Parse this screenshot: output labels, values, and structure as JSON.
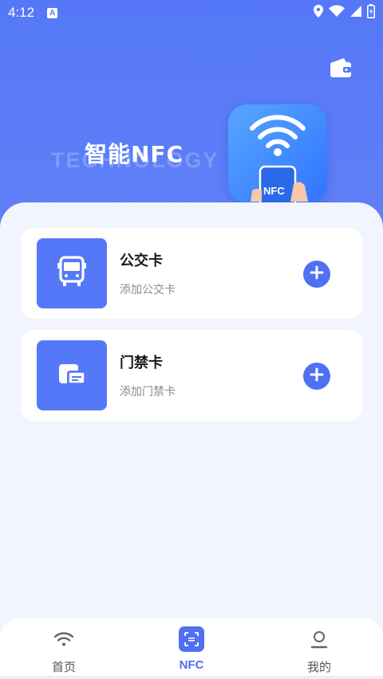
{
  "status_bar": {
    "time": "4:12",
    "app_indicator": "A",
    "icons": [
      "location-icon",
      "wifi-icon",
      "signal-icon",
      "battery-icon"
    ]
  },
  "header": {
    "title": "智能NFC",
    "watermark": "TECHNOLOGY",
    "illustration_label": "NFC",
    "wallet_icon": "wallet-icon"
  },
  "cards": [
    {
      "icon": "bus-icon",
      "title": "公交卡",
      "subtitle": "添加公交卡",
      "action_icon": "plus-icon"
    },
    {
      "icon": "access-card-icon",
      "title": "门禁卡",
      "subtitle": "添加门禁卡",
      "action_icon": "plus-icon"
    }
  ],
  "bottom_nav": {
    "items": [
      {
        "label": "首页",
        "icon": "wifi-icon",
        "active": false
      },
      {
        "label": "NFC",
        "icon": "scan-icon",
        "active": true
      },
      {
        "label": "我的",
        "icon": "user-icon",
        "active": false
      }
    ]
  },
  "colors": {
    "primary": "#5578f8",
    "accent": "#4f70f2",
    "background": "#f2f5fd",
    "card": "#ffffff"
  }
}
